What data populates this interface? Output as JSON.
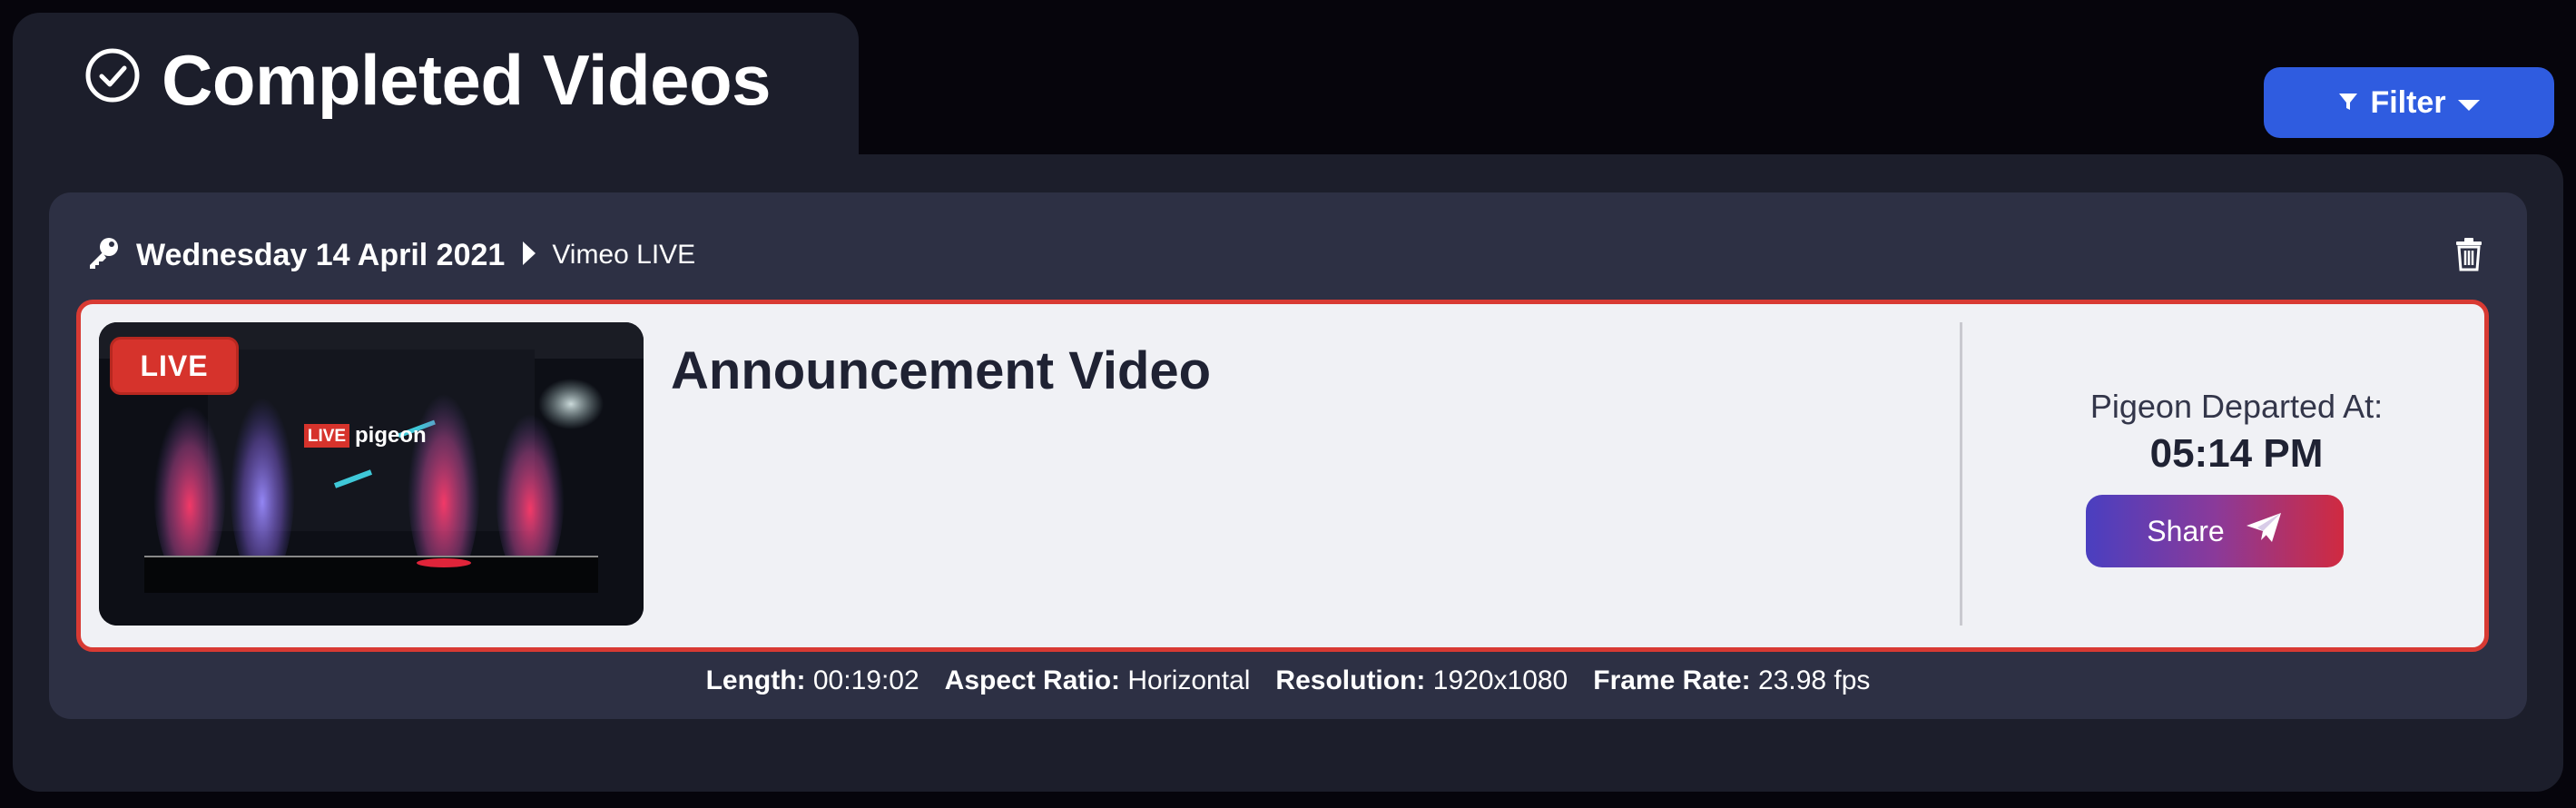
{
  "page": {
    "title": "Completed Videos",
    "filter_label": "Filter"
  },
  "card": {
    "date": "Wednesday 14 April 2021",
    "platform": "Vimeo LIVE",
    "video": {
      "live_badge": "LIVE",
      "title": "Announcement Video",
      "departed_label": "Pigeon Departed At:",
      "departed_time": "05:14 PM",
      "share_label": "Share"
    },
    "meta": {
      "length_label": "Length:",
      "length_value": "00:19:02",
      "aspect_label": "Aspect Ratio:",
      "aspect_value": "Horizontal",
      "resolution_label": "Resolution:",
      "resolution_value": "1920x1080",
      "framerate_label": "Frame Rate:",
      "framerate_value": "23.98 fps"
    }
  },
  "icons": {
    "title": "check-circle-icon",
    "filter": "funnel-icon",
    "dropdown": "caret-down-icon",
    "header": "key-icon",
    "separator": "caret-right-icon",
    "delete": "trash-icon",
    "share": "paper-plane-icon"
  },
  "colors": {
    "accent_blue": "#2f5ce0",
    "live_red": "#d6332c",
    "card_border": "#d83a33",
    "share_gradient_start": "#4a3fc0",
    "share_gradient_end": "#d02a40"
  }
}
